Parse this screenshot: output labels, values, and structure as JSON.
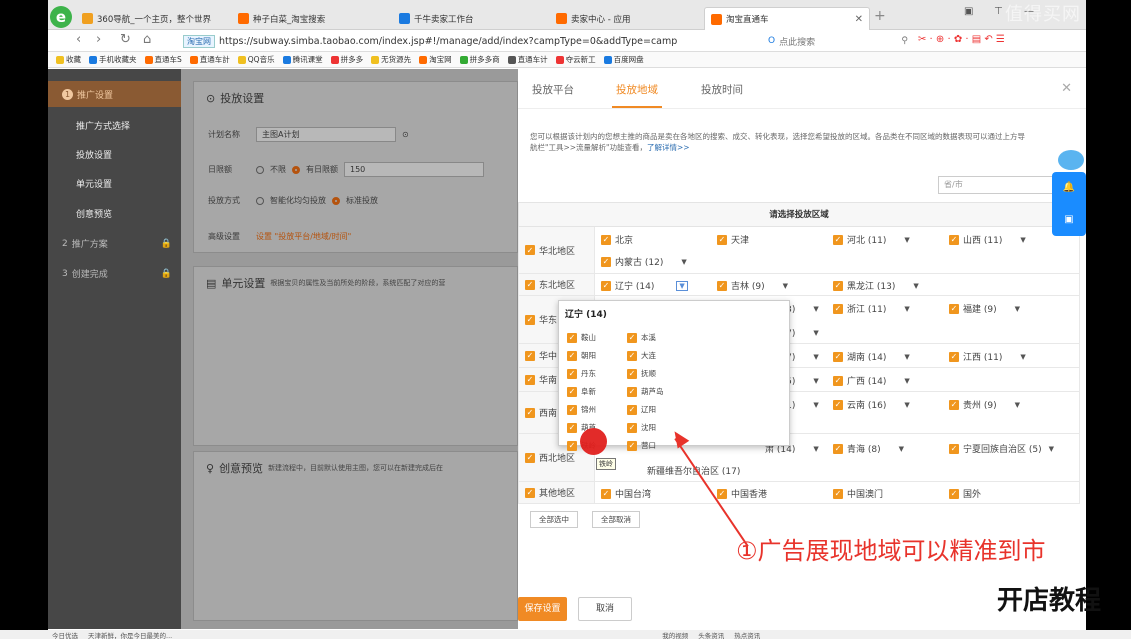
{
  "browser": {
    "tabs": [
      {
        "label": "360导航_一个主页，整个世界",
        "color": "#f0a020"
      },
      {
        "label": "种子白菜_淘宝搜索",
        "color": "#ff6a00"
      },
      {
        "label": "千牛卖家工作台",
        "color": "#1a7ae0"
      },
      {
        "label": "卖家中心 - 应用",
        "color": "#ff6a00"
      },
      {
        "label": "淘宝直通车",
        "color": "#ff6a00"
      }
    ],
    "active_tab": 4,
    "url_badge": "淘宝网",
    "url": "https://subway.simba.taobao.com/index.jsp#!/manage/add/index?campType=0&addType=camp",
    "search_placeholder": "点此搜索",
    "bookmarks": [
      "收藏",
      "手机收藏夹",
      "直通车S",
      "直通车計",
      "QQ音乐",
      "腾讯课堂",
      "拼多多",
      "无货源先",
      "淘宝网",
      "拼多多商",
      "直通车计",
      "夺云新工",
      "百度网盘"
    ]
  },
  "sidebar": {
    "section1": "推广设置",
    "section1_num": "1",
    "items": [
      "推广方式选择",
      "投放设置",
      "单元设置",
      "创意预览"
    ],
    "section2": "推广方案",
    "section2_num": "2",
    "section3": "创建完成",
    "section3_num": "3"
  },
  "main": {
    "card1_title": "投放设置",
    "plan_name_label": "计划名称",
    "plan_name_value": "主图A计划",
    "daily_limit_label": "日限额",
    "no_limit": "不限",
    "has_limit": "有日限额",
    "limit_value": "150",
    "delivery_label": "投放方式",
    "smart": "智能化均匀投放",
    "standard": "标准投放",
    "advanced_label": "高级设置",
    "advanced_value": "设置 \"投放平台/地域/时间\"",
    "card2_title": "单元设置",
    "card2_desc": "根据宝贝的属性及当前所处的阶段，系统匹配了对应的营",
    "card3_title": "创意预览",
    "card3_desc": "新建流程中，目前默认使用主图，您可以在新建完成后在"
  },
  "modal": {
    "tabs": [
      "投放平台",
      "投放地域",
      "投放时间"
    ],
    "active_tab": 1,
    "desc1": "您可以根据该计划内的您想主推的商品是卖在各地区的搜索、成交、转化表现，选择您希望投放的区域。各品类在不同区域的数据表现可以通过上方导",
    "desc2": "航栏\"工具>>流量解析\"功能查看，",
    "desc_link": "了解详情>>",
    "city_placeholder": "省/市",
    "grid_title": "请选择投放区域",
    "regions": {
      "north": {
        "label": "华北地区",
        "cells": [
          "北京",
          "天津",
          "河北 (11)",
          "山西 (11)",
          "内蒙古 (12)"
        ]
      },
      "northeast": {
        "label": "东北地区",
        "cells": [
          "辽宁 (14)",
          "吉林 (9)",
          "黑龙江 (13)"
        ]
      },
      "east": {
        "label": "华东",
        "cells": [
          "苏 (13)",
          "浙江 (11)",
          "福建 (9)",
          "东 (17)"
        ]
      },
      "central": {
        "label": "华中",
        "cells": [
          "北 (17)",
          "湖南 (14)",
          "江西 (11)"
        ]
      },
      "south": {
        "label": "华南",
        "cells": [
          "南 (15)",
          "广西 (14)"
        ]
      },
      "southwest": {
        "label": "西南",
        "cells": [
          "川 (21)",
          "云南 (16)",
          "贵州 (9)"
        ]
      },
      "northwest": {
        "label": "西北地区",
        "cells": [
          "肃 (14)",
          "青海 (8)",
          "宁夏回族自治区 (5)",
          "新疆维吾尔自治区 (17)"
        ]
      },
      "other": {
        "label": "其他地区",
        "cells": [
          "中国台湾",
          "中国香港",
          "中国澳门",
          "国外"
        ]
      }
    },
    "select_all": "全部选中",
    "cancel_all": "全部取消",
    "save": "保存设置",
    "cancel": "取消"
  },
  "popup": {
    "title": "辽宁 (14)",
    "cities_left": [
      "鞍山",
      "朝阳",
      "丹东",
      "阜新",
      "锦州",
      "葫芦",
      "铁岭"
    ],
    "cities_right": [
      "本溪",
      "大连",
      "抚顺",
      "葫芦岛",
      "辽阳",
      "沈阳",
      "营口"
    ],
    "tooltip": "铁岭"
  },
  "annotation": "①广告展现地域可以精准到市",
  "brand": "开店教程",
  "watermark": "值得买网",
  "status": [
    "今日优选",
    "天津新鲜，你是今日最美的...",
    "我的视频",
    "头条资讯",
    "热点资讯"
  ],
  "colors": {
    "accent": "#f08a24",
    "check": "#f0961e",
    "annotation": "#e8332b"
  }
}
